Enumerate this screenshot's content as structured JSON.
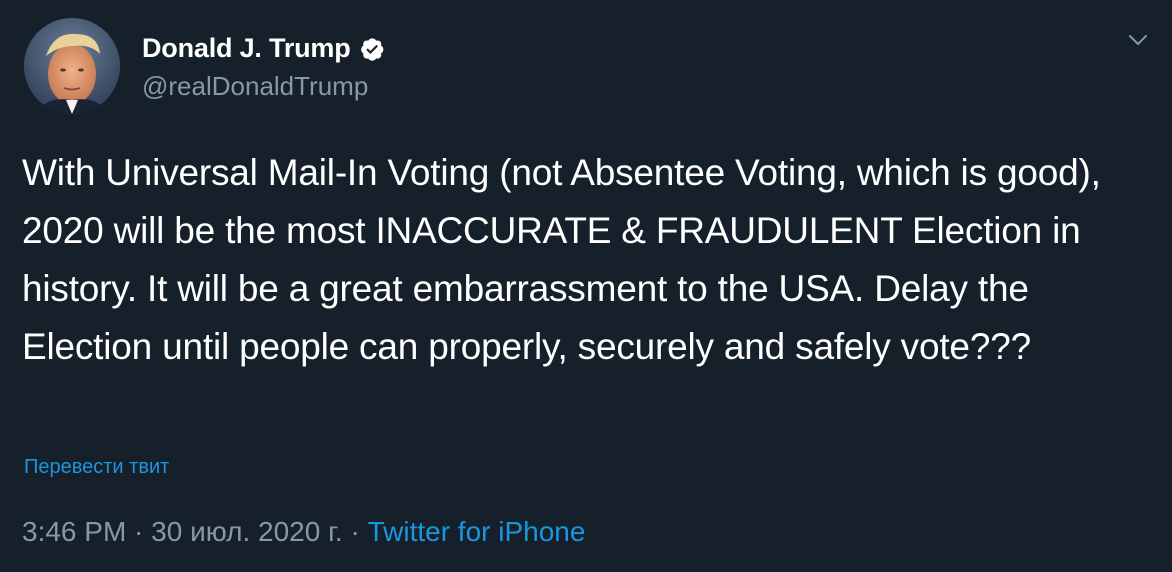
{
  "author": {
    "display_name": "Donald J. Trump",
    "handle": "@realDonaldTrump",
    "avatar_icon": "profile-photo",
    "verified_icon": "verified-badge-icon"
  },
  "tweet": {
    "text": "With Universal Mail-In Voting (not Absentee Voting, which is good), 2020 will be the most INACCURATE & FRAUDULENT Election in history. It will be a great embarrassment to the USA. Delay the Election until people can properly, securely and safely vote???",
    "translate_label": "Перевести твит"
  },
  "meta": {
    "time": "3:46 PM",
    "separator": " · ",
    "date": "30 июл. 2020 г.",
    "separator2": " · ",
    "source": "Twitter for iPhone"
  },
  "colors": {
    "background": "#15202b",
    "text": "#ffffff",
    "secondary": "#8899a6",
    "link": "#1b95e0"
  }
}
